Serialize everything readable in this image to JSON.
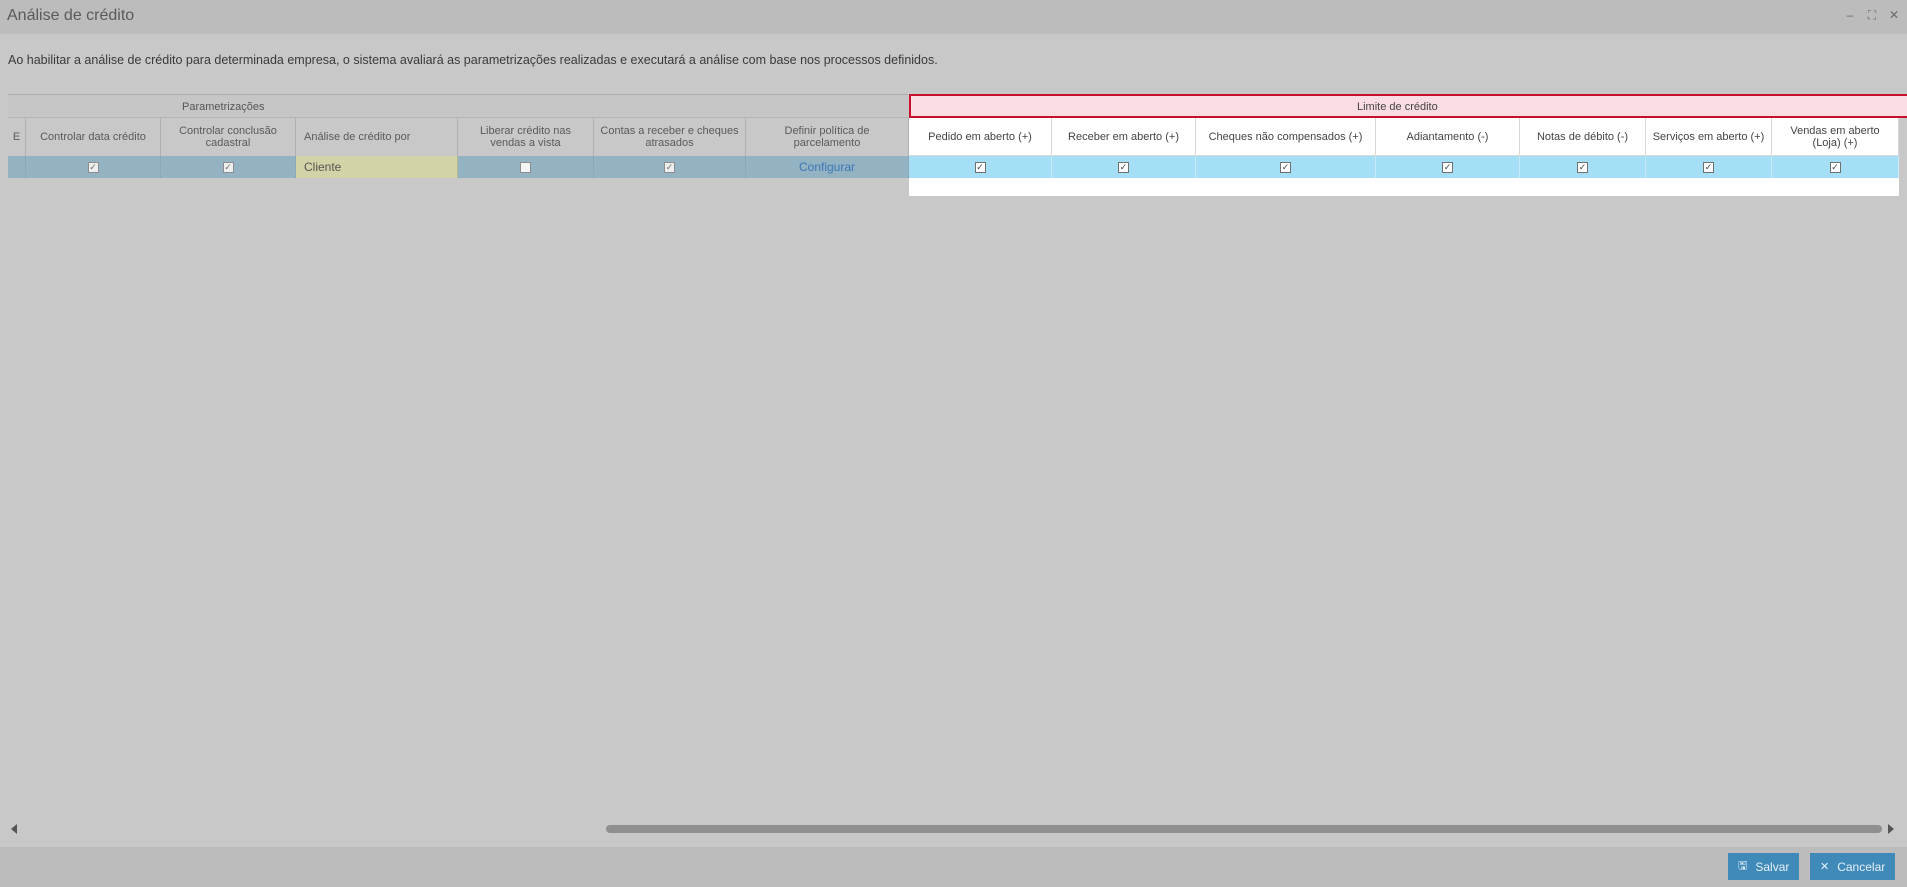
{
  "window": {
    "title": "Análise de crédito",
    "controls": [
      {
        "name": "minimize-icon",
        "glyph": "–"
      },
      {
        "name": "maximize-icon",
        "glyph": "⛶"
      },
      {
        "name": "close-icon",
        "glyph": "✕"
      }
    ]
  },
  "description": "Ao habilitar a análise de crédito para determinada empresa, o sistema avaliará as parametrizações realizadas e executará a análise com base nos processos definidos.",
  "groups": {
    "parametrizacoes": "Parametrizações",
    "limite": "Limite de crédito"
  },
  "columns": {
    "stub": "E",
    "controlar_data": "Controlar data crédito",
    "controlar_conclusao": "Controlar conclusão cadastral",
    "analise_por": "Análise de crédito por",
    "liberar_credito": "Liberar crédito nas vendas a vista",
    "contas_receber": "Contas a receber e cheques atrasados",
    "politica_parcelamento": "Definir política de parcelamento",
    "pedido_aberto": "Pedido em aberto (+)",
    "receber_aberto": "Receber em aberto (+)",
    "cheques": "Cheques não compensados (+)",
    "adiantamento": "Adiantamento (-)",
    "notas_debito": "Notas de débito (-)",
    "servicos_aberto": "Serviços em aberto (+)",
    "vendas_aberto": "Vendas em aberto (Loja) (+)"
  },
  "row": {
    "controlar_data": true,
    "controlar_conclusao": true,
    "analise_por": "Cliente",
    "liberar_credito": false,
    "contas_receber": true,
    "politica_parcelamento": "Configurar",
    "pedido_aberto": true,
    "receber_aberto": true,
    "cheques": true,
    "adiantamento": true,
    "notas_debito": true,
    "servicos_aberto": true,
    "vendas_aberto": true
  },
  "footer": {
    "save_label": "Salvar",
    "cancel_label": "Cancelar"
  },
  "colors": {
    "accent_button": "#3f8ab8",
    "limit_border": "#c8102e",
    "selected_row": "#a5dff5"
  }
}
